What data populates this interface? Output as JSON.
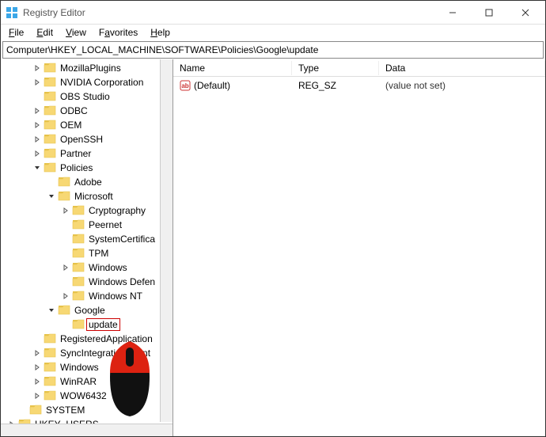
{
  "window": {
    "title": "Registry Editor"
  },
  "menu": {
    "file": "File",
    "edit": "Edit",
    "view": "View",
    "favorites": "Favorites",
    "help": "Help"
  },
  "address": "Computer\\HKEY_LOCAL_MACHINE\\SOFTWARE\\Policies\\Google\\update",
  "list_headers": {
    "name": "Name",
    "type": "Type",
    "data": "Data"
  },
  "list_rows": [
    {
      "name": "(Default)",
      "type": "REG_SZ",
      "data": "(value not set)"
    }
  ],
  "tree": {
    "items": [
      {
        "indent": 2,
        "toggle": ">",
        "label": "MozillaPlugins"
      },
      {
        "indent": 2,
        "toggle": ">",
        "label": "NVIDIA Corporation"
      },
      {
        "indent": 2,
        "toggle": "",
        "label": "OBS Studio"
      },
      {
        "indent": 2,
        "toggle": ">",
        "label": "ODBC"
      },
      {
        "indent": 2,
        "toggle": ">",
        "label": "OEM"
      },
      {
        "indent": 2,
        "toggle": ">",
        "label": "OpenSSH"
      },
      {
        "indent": 2,
        "toggle": ">",
        "label": "Partner"
      },
      {
        "indent": 2,
        "toggle": "v",
        "label": "Policies"
      },
      {
        "indent": 3,
        "toggle": "",
        "label": "Adobe"
      },
      {
        "indent": 3,
        "toggle": "v",
        "label": "Microsoft"
      },
      {
        "indent": 4,
        "toggle": ">",
        "label": "Cryptography"
      },
      {
        "indent": 4,
        "toggle": "",
        "label": "Peernet"
      },
      {
        "indent": 4,
        "toggle": "",
        "label": "SystemCertifica"
      },
      {
        "indent": 4,
        "toggle": "",
        "label": "TPM"
      },
      {
        "indent": 4,
        "toggle": ">",
        "label": "Windows"
      },
      {
        "indent": 4,
        "toggle": "",
        "label": "Windows Defen"
      },
      {
        "indent": 4,
        "toggle": ">",
        "label": "Windows NT"
      },
      {
        "indent": 3,
        "toggle": "v",
        "label": "Google"
      },
      {
        "indent": 4,
        "toggle": "",
        "label": "update",
        "selected": true
      },
      {
        "indent": 2,
        "toggle": "",
        "label": "RegisteredApplication"
      },
      {
        "indent": 2,
        "toggle": ">",
        "label": "SyncIntegrationClient"
      },
      {
        "indent": 2,
        "toggle": ">",
        "label": "Windows"
      },
      {
        "indent": 2,
        "toggle": ">",
        "label": "WinRAR"
      },
      {
        "indent": 2,
        "toggle": ">",
        "label": "WOW6432"
      },
      {
        "indent": 1,
        "toggle": "",
        "label": "SYSTEM"
      },
      {
        "indent": 0,
        "toggle": ">",
        "label": "HKEY_USERS"
      }
    ]
  },
  "icons": {
    "folder_fill": "#F7D874",
    "folder_tab": "#E6C24A"
  }
}
